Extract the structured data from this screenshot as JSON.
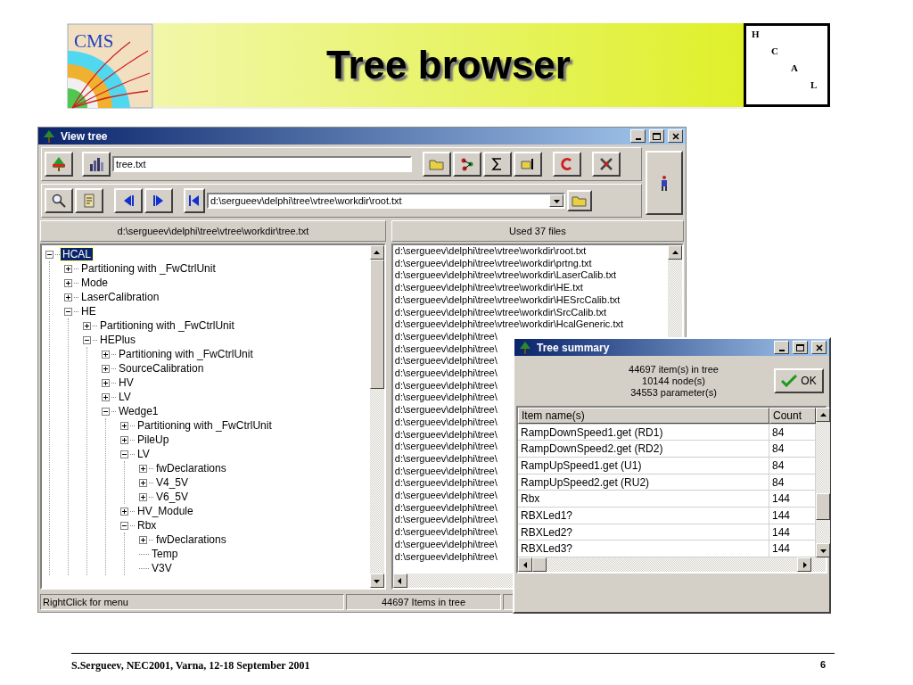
{
  "slide": {
    "title": "Tree browser",
    "logo_text": "CMS",
    "hcal_letters": [
      "H",
      "C",
      "A",
      "L"
    ],
    "footer": "S.Sergueev, NEC2001, Varna, 12-18 September 2001",
    "page_number": "6"
  },
  "window": {
    "title": "View tree",
    "file_field": {
      "value": "tree.txt"
    },
    "path_field": {
      "value": "d:\\sergueev\\delphi\\tree\\vtree\\workdir\\root.txt"
    },
    "left_header": "d:\\sergueev\\delphi\\tree\\vtree\\workdir\\tree.txt",
    "right_header": "Used 37 files",
    "tree": [
      {
        "label": "HCAL",
        "kind": "branch",
        "expanded": true,
        "selected": true,
        "children": [
          {
            "label": "Partitioning with _FwCtrlUnit",
            "kind": "branch",
            "expanded": false,
            "selected": false
          },
          {
            "label": "Mode",
            "kind": "branch",
            "expanded": false,
            "selected": false
          },
          {
            "label": "LaserCalibration",
            "kind": "branch",
            "expanded": false,
            "selected": false
          },
          {
            "label": "HE",
            "kind": "branch",
            "expanded": true,
            "selected": false,
            "children": [
              {
                "label": "Partitioning with _FwCtrlUnit",
                "kind": "branch",
                "expanded": false,
                "selected": false
              },
              {
                "label": "HEPlus",
                "kind": "branch",
                "expanded": true,
                "selected": false,
                "children": [
                  {
                    "label": "Partitioning with _FwCtrlUnit",
                    "kind": "branch",
                    "expanded": false,
                    "selected": false
                  },
                  {
                    "label": "SourceCalibration",
                    "kind": "branch",
                    "expanded": false,
                    "selected": false
                  },
                  {
                    "label": "HV",
                    "kind": "branch",
                    "expanded": false,
                    "selected": false
                  },
                  {
                    "label": "LV",
                    "kind": "branch",
                    "expanded": false,
                    "selected": false
                  },
                  {
                    "label": "Wedge1",
                    "kind": "branch",
                    "expanded": true,
                    "selected": false,
                    "children": [
                      {
                        "label": "Partitioning with _FwCtrlUnit",
                        "kind": "branch",
                        "expanded": false,
                        "selected": false
                      },
                      {
                        "label": "PileUp",
                        "kind": "branch",
                        "expanded": false,
                        "selected": false
                      },
                      {
                        "label": "LV",
                        "kind": "branch",
                        "expanded": true,
                        "selected": false,
                        "children": [
                          {
                            "label": "fwDeclarations",
                            "kind": "branch",
                            "expanded": false,
                            "selected": false
                          },
                          {
                            "label": "V4_5V",
                            "kind": "branch",
                            "expanded": false,
                            "selected": false
                          },
                          {
                            "label": "V6_5V",
                            "kind": "branch",
                            "expanded": false,
                            "selected": false
                          }
                        ]
                      },
                      {
                        "label": "HV_Module",
                        "kind": "branch",
                        "expanded": false,
                        "selected": false
                      },
                      {
                        "label": "Rbx",
                        "kind": "branch",
                        "expanded": true,
                        "selected": false,
                        "children": [
                          {
                            "label": "fwDeclarations",
                            "kind": "branch",
                            "expanded": false,
                            "selected": false
                          },
                          {
                            "label": "Temp",
                            "kind": "leaf",
                            "selected": false
                          },
                          {
                            "label": "V3V",
                            "kind": "leaf",
                            "selected": false
                          }
                        ]
                      }
                    ]
                  }
                ]
              }
            ]
          }
        ]
      }
    ],
    "files": [
      "d:\\sergueev\\delphi\\tree\\vtree\\workdir\\root.txt",
      "d:\\sergueev\\delphi\\tree\\vtree\\workdir\\prtng.txt",
      "d:\\sergueev\\delphi\\tree\\vtree\\workdir\\LaserCalib.txt",
      "d:\\sergueev\\delphi\\tree\\vtree\\workdir\\HE.txt",
      "d:\\sergueev\\delphi\\tree\\vtree\\workdir\\HESrcCalib.txt",
      "d:\\sergueev\\delphi\\tree\\vtree\\workdir\\SrcCalib.txt",
      "d:\\sergueev\\delphi\\tree\\vtree\\workdir\\HcalGeneric.txt",
      "d:\\sergueev\\delphi\\tree\\",
      "d:\\sergueev\\delphi\\tree\\",
      "d:\\sergueev\\delphi\\tree\\",
      "d:\\sergueev\\delphi\\tree\\",
      "d:\\sergueev\\delphi\\tree\\",
      "d:\\sergueev\\delphi\\tree\\",
      "d:\\sergueev\\delphi\\tree\\",
      "d:\\sergueev\\delphi\\tree\\",
      "d:\\sergueev\\delphi\\tree\\",
      "d:\\sergueev\\delphi\\tree\\",
      "d:\\sergueev\\delphi\\tree\\",
      "d:\\sergueev\\delphi\\tree\\",
      "d:\\sergueev\\delphi\\tree\\",
      "d:\\sergueev\\delphi\\tree\\",
      "d:\\sergueev\\delphi\\tree\\",
      "d:\\sergueev\\delphi\\tree\\",
      "d:\\sergueev\\delphi\\tree\\",
      "d:\\sergueev\\delphi\\tree\\",
      "d:\\sergueev\\delphi\\tree\\"
    ],
    "status_bar": [
      "RightClick for menu",
      "44697 Items in tree"
    ]
  },
  "dialog": {
    "title": "Tree summary",
    "stats": [
      "44697 item(s) in tree",
      "10144 node(s)",
      "34553 parameter(s)"
    ],
    "ok_button": "OK",
    "columns": [
      "Item name(s)",
      "Count"
    ],
    "rows": [
      [
        "RampDownSpeed1.get (RD1)",
        "84"
      ],
      [
        "RampDownSpeed2.get (RD2)",
        "84"
      ],
      [
        "RampUpSpeed1.get (U1)",
        "84"
      ],
      [
        "RampUpSpeed2.get (RU2)",
        "84"
      ],
      [
        "Rbx",
        "144"
      ],
      [
        "RBXLed1?",
        "144"
      ],
      [
        "RBXLed2?",
        "144"
      ],
      [
        "RBXLed3?",
        "144"
      ]
    ]
  }
}
